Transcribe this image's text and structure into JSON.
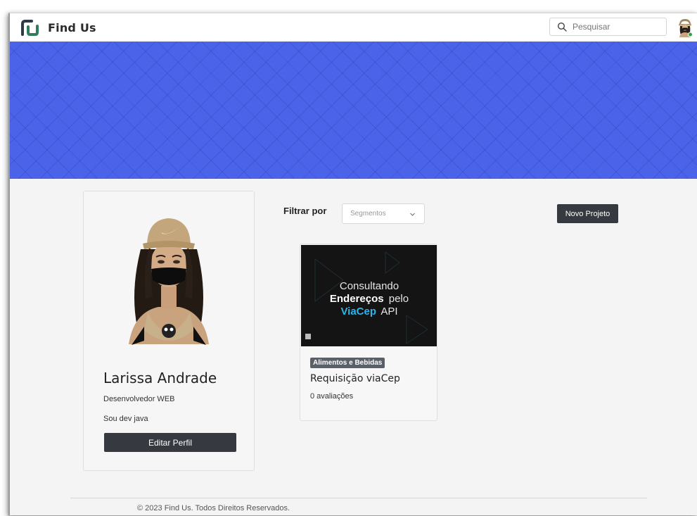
{
  "navbar": {
    "brand": "Find Us",
    "search_placeholder": "Pesquisar"
  },
  "profile": {
    "name": "Larissa Andrade",
    "role": "Desenvolvedor WEB",
    "bio": "Sou dev java",
    "edit_label": "Editar Perfil"
  },
  "filter": {
    "label": "Filtrar por",
    "selected": "Segmentos"
  },
  "new_project_label": "Novo Projeto",
  "project": {
    "thumb_line1": "Consultando",
    "thumb_line2a": "Endereços",
    "thumb_line2b": "pelo",
    "thumb_line3a": "ViaCep",
    "thumb_line3b": "API",
    "badge": "Alimentos e Bebidas",
    "title": "Requisição viaCep",
    "rating": "0 avaliações"
  },
  "footer": {
    "text": "© 2023 Find Us. Todos Direitos Reservados."
  },
  "colors": {
    "banner": "#4b63e9",
    "button_dark": "#363a40",
    "brand_green": "#2e7d5b",
    "badge": "#5a6068"
  },
  "icons": [
    "brand-logo-icon",
    "search-icon",
    "user-avatar",
    "chevron-down-icon"
  ]
}
